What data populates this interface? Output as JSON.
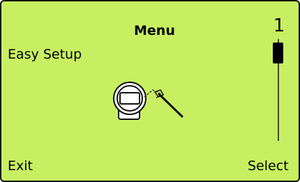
{
  "header": {
    "title": "Menu"
  },
  "menu": {
    "selected_item": "Easy Setup"
  },
  "scrollbar": {
    "position_label": "1"
  },
  "illustration": {
    "icon": "device-wrench-icon"
  },
  "softkeys": {
    "left_label": "Exit",
    "right_label": "Select"
  },
  "colors": {
    "display_background": "#c8ef61",
    "text": "#000000"
  }
}
